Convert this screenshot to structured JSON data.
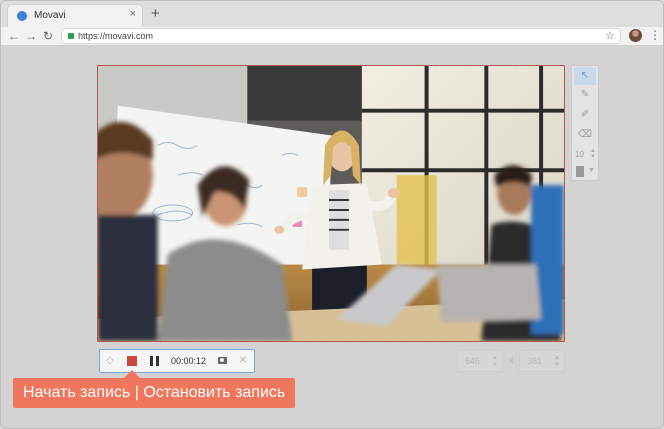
{
  "browser": {
    "tab_title": "Movavi",
    "tab_close": "×",
    "new_tab": "+",
    "url": "https://movavi.com",
    "back": "←",
    "forward": "→",
    "reload": "↻",
    "star": "☆",
    "menu": "⋮"
  },
  "draw_panel": {
    "tools": [
      "cursor-icon",
      "pencil-icon",
      "marker-icon",
      "eraser-icon"
    ],
    "brush_size": "10",
    "spin_up": "▲",
    "spin_down": "▼",
    "color_caret": "▼"
  },
  "recorder": {
    "reset_icon": "◇",
    "timer": "00:00:12",
    "close_icon": "✕"
  },
  "dimensions": {
    "width": "646",
    "height": "381",
    "separator": "x"
  },
  "callout": {
    "text": "Начать запись | Остановить запись"
  },
  "colors": {
    "frame_border": "#e14a3f",
    "callout_bg": "#f0775d",
    "stop_button": "#c64a3a",
    "active_tool": "#c9d8ec"
  }
}
